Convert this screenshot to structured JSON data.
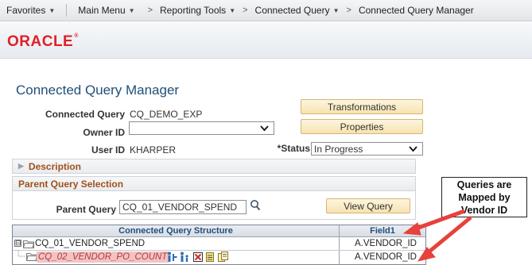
{
  "nav": {
    "favorites": "Favorites",
    "main_menu": "Main Menu",
    "breadcrumbs": [
      "Reporting Tools",
      "Connected Query",
      "Connected Query Manager"
    ]
  },
  "logo": {
    "text": "ORACLE",
    "tm": "®"
  },
  "page": {
    "title": "Connected Query Manager"
  },
  "form": {
    "connected_query_label": "Connected Query",
    "connected_query_value": "CQ_DEMO_EXP",
    "owner_id_label": "Owner ID",
    "owner_id_value": "",
    "user_id_label": "User ID",
    "user_id_value": "KHARPER",
    "status_label": "*Status",
    "status_value": "In Progress",
    "transformations_button": "Transformations",
    "properties_button": "Properties"
  },
  "description_section": {
    "label": "Description"
  },
  "parent_section": {
    "title": "Parent Query Selection",
    "parent_query_label": "Parent Query",
    "parent_query_value": "CQ_01_VENDOR_SPEND",
    "view_query_button": "View Query"
  },
  "grid": {
    "headers": [
      "Connected Query Structure",
      "Field1"
    ],
    "rows": [
      {
        "name": "CQ_01_VENDOR_SPEND",
        "field1": "A.VENDOR_ID",
        "toggle": "⊟"
      },
      {
        "name": "CQ_02_VENDOR_PO_COUNT",
        "field1": "A.VENDOR_ID"
      }
    ]
  },
  "callout": {
    "line1": "Queries are",
    "line2": "Mapped by",
    "line3": "Vendor ID"
  },
  "colors": {
    "title": "#1f4e79",
    "section": "#a0501b",
    "oracle_red": "#e01f26",
    "arrow": "#e8413c"
  }
}
